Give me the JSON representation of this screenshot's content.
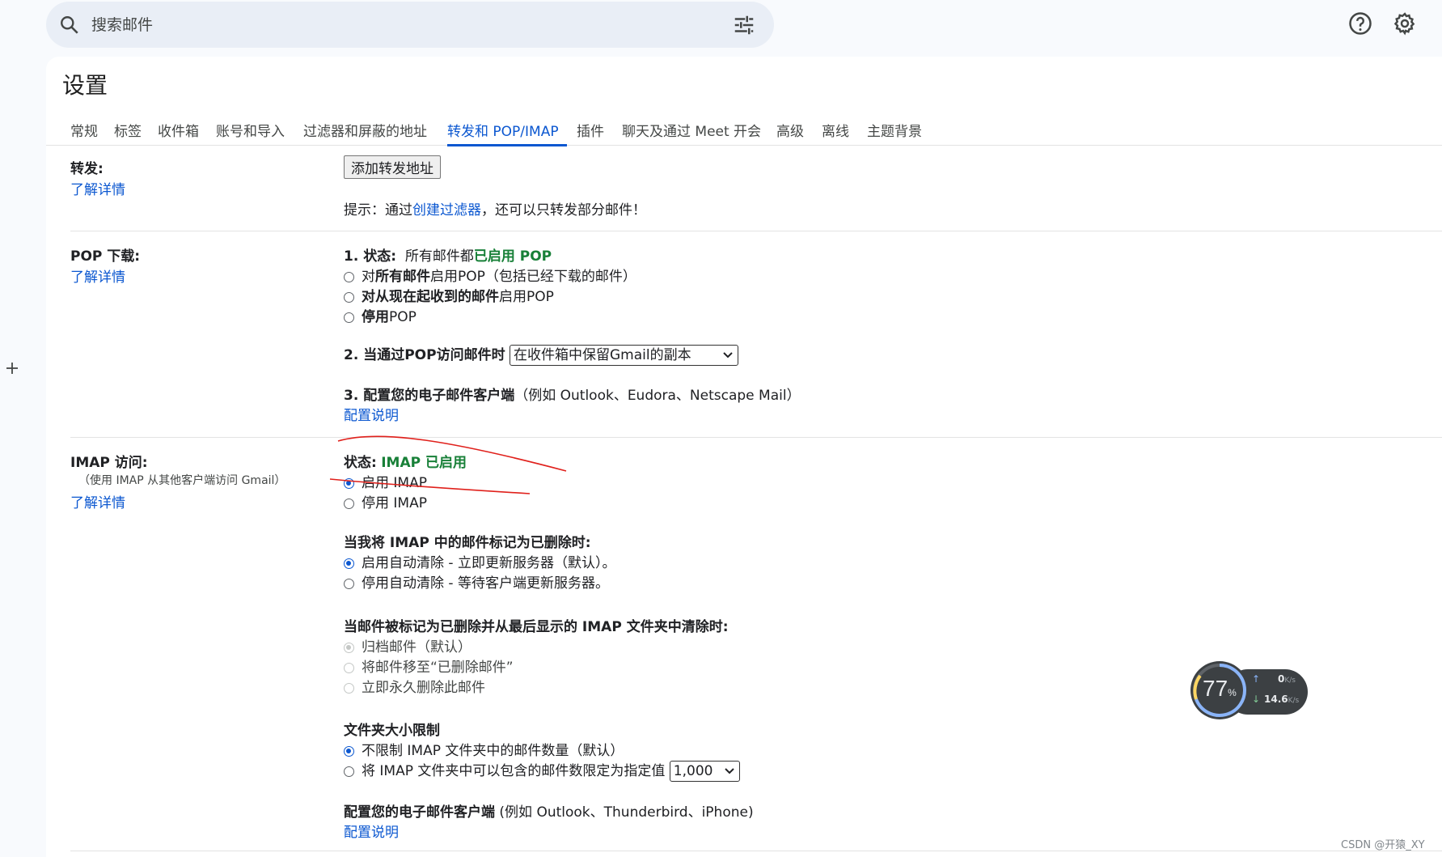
{
  "search": {
    "placeholder": "搜索邮件"
  },
  "icons": {
    "search": "search-icon",
    "filter": "tune-icon",
    "help": "help-icon",
    "settings": "gear-icon",
    "add": "plus-icon"
  },
  "page_title": "设置",
  "tabs": [
    "常规",
    "标签",
    "收件箱",
    "账号和导入",
    "过滤器和屏蔽的地址",
    "转发和 POP/IMAP",
    "插件",
    "聊天及通过 Meet 开会",
    "高级",
    "离线",
    "主题背景"
  ],
  "active_tab": "转发和 POP/IMAP",
  "forwarding": {
    "label": "转发:",
    "learn_more": "了解详情",
    "add_button": "添加转发地址",
    "tip_prefix": "提示：通过",
    "tip_link": "创建过滤器",
    "tip_suffix": "，还可以只转发部分邮件！"
  },
  "pop": {
    "label": "POP 下载:",
    "learn_more": "了解详情",
    "status_label": "1. 状态:",
    "status_text": "所有邮件都",
    "status_value": "已启用 POP",
    "opt1_pre": "对",
    "opt1_bold": "所有邮件",
    "opt1_post": "启用POP（包括已经下载的邮件）",
    "opt2_bold": "对从现在起收到的邮件",
    "opt2_post": "启用POP",
    "opt3_bold": "停用",
    "opt3_post": "POP",
    "when_label": "2. 当通过POP访问邮件时",
    "when_select": "在收件箱中保留Gmail的副本",
    "config_label": "3. 配置您的电子邮件客户端",
    "config_example": "（例如 Outlook、Eudora、Netscape Mail）",
    "config_link": "配置说明"
  },
  "imap": {
    "label": "IMAP 访问:",
    "sublabel": "（使用 IMAP 从其他客户端访问 Gmail）",
    "learn_more": "了解详情",
    "status_label": "状态:",
    "status_value": "IMAP 已启用",
    "enable": "启用 IMAP",
    "disable": "停用 IMAP",
    "deleted_heading": "当我将 IMAP 中的邮件标记为已删除时:",
    "expunge_on": "启用自动清除 - 立即更新服务器（默认）。",
    "expunge_off": "停用自动清除 - 等待客户端更新服务器。",
    "expunge_heading": "当邮件被标记为已删除并从最后显示的 IMAP 文件夹中清除时:",
    "archive": "归档邮件（默认）",
    "move_trash": "将邮件移至“已删除邮件”",
    "delete_forever": "立即永久删除此邮件",
    "folder_heading": "文件夹大小限制",
    "no_limit": "不限制 IMAP 文件夹中的邮件数量（默认）",
    "limit_pre": "将 IMAP 文件夹中可以包含的邮件数限定为指定值",
    "limit_select": "1,000",
    "client_heading": "配置您的电子邮件客户端",
    "client_example": "(例如 Outlook、Thunderbird、iPhone)",
    "client_link": "配置说明"
  },
  "net_widget": {
    "percent": "77",
    "percent_unit": "%",
    "up": "0",
    "down": "14.6",
    "unit": "K/s"
  },
  "watermark": "CSDN @开猿_XY",
  "colors": {
    "accent": "#0b57d0",
    "green": "#188038",
    "red_annotation": "#e0201b"
  }
}
